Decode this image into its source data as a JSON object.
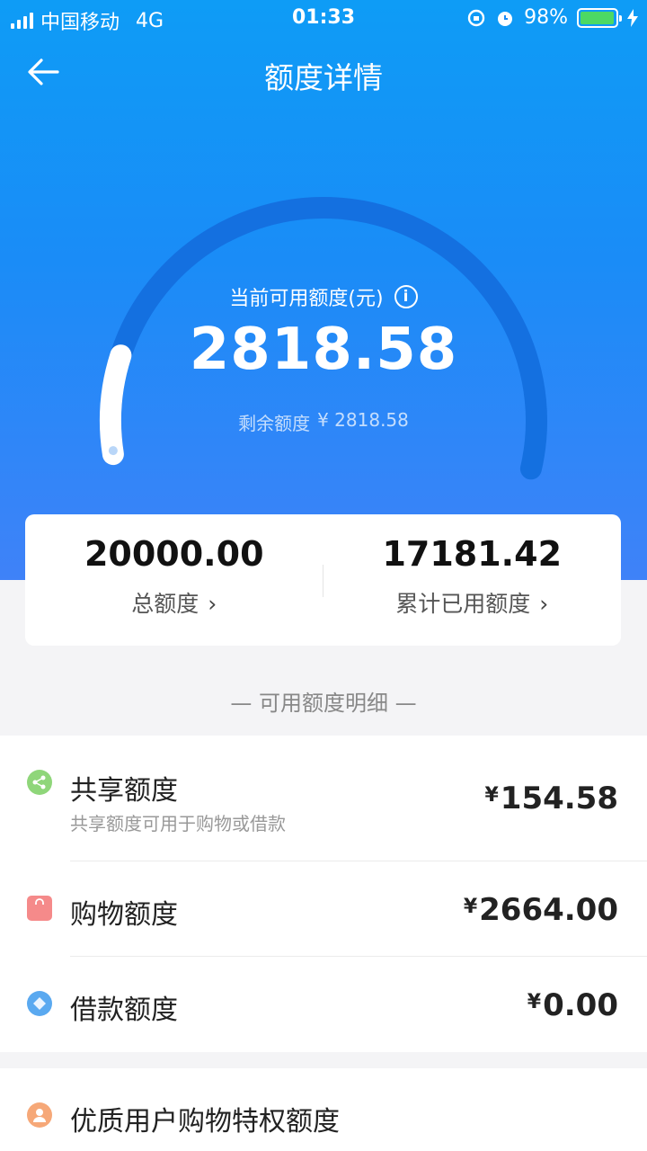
{
  "status_bar": {
    "carrier": "中国移动",
    "network": "4G",
    "time": "01:33",
    "battery": "98%",
    "battery_level": 0.98
  },
  "nav": {
    "title": "额度详情",
    "back_icon": "arrow-left-icon"
  },
  "gauge": {
    "label": "当前可用额度(元)",
    "amount": "2818.58",
    "remain_label": "剩余额度",
    "remain_value": "¥ 2818.58",
    "used_fraction": 0.14,
    "track_color": "#1470e0",
    "progress_color": "#ffffff"
  },
  "summary": {
    "total_value": "20000.00",
    "total_label": "总额度",
    "used_value": "17181.42",
    "used_label": "累计已用额度"
  },
  "section_title": "— 可用额度明细 —",
  "details": [
    {
      "name": "共享额度",
      "sub": "共享额度可用于购物或借款",
      "currency": "¥",
      "amount": "154.58",
      "icon": "share-icon"
    },
    {
      "name": "购物额度",
      "currency": "¥",
      "amount": "2664.00",
      "icon": "shopping-bag-icon"
    },
    {
      "name": "借款额度",
      "currency": "¥",
      "amount": "0.00",
      "icon": "diamond-icon"
    }
  ],
  "extra": {
    "name": "优质用户购物特权额度",
    "icon": "user-icon"
  },
  "colors": {
    "hero_top": "#0e9cf6",
    "hero_bottom": "#3f82f8",
    "page_bg": "#f4f4f6"
  }
}
